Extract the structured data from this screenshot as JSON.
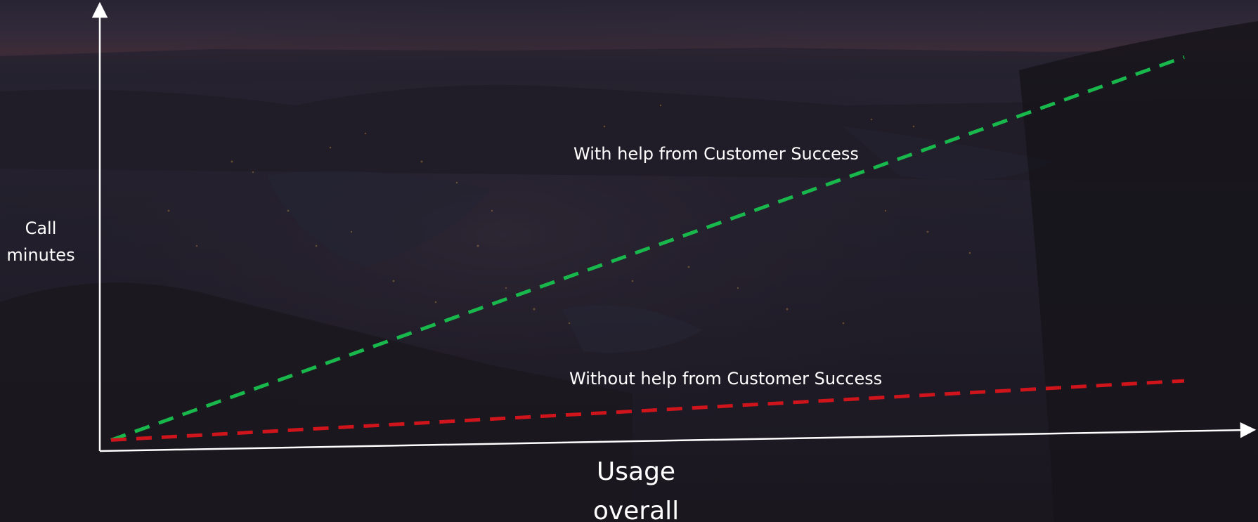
{
  "chart_data": {
    "type": "line",
    "title": "",
    "xlabel": "Usage\noverall",
    "ylabel": "Call\nminutes",
    "xlim": [
      0,
      1
    ],
    "ylim": [
      0,
      1
    ],
    "grid": false,
    "legend": "inline labels",
    "series": [
      {
        "name": "With help from Customer Success",
        "color": "#19b84c",
        "dash": "dashed",
        "x": [
          0,
          1
        ],
        "y": [
          0.01,
          0.98
        ]
      },
      {
        "name": "Without help from Customer Success",
        "color": "#d0141c",
        "dash": "dashed",
        "x": [
          0,
          1
        ],
        "y": [
          0.01,
          0.16
        ]
      }
    ]
  },
  "colors": {
    "axis": "#ffffff",
    "text": "#ffffff",
    "background": "#211e2c"
  },
  "background_image": "night-landscape-aerial-photo"
}
